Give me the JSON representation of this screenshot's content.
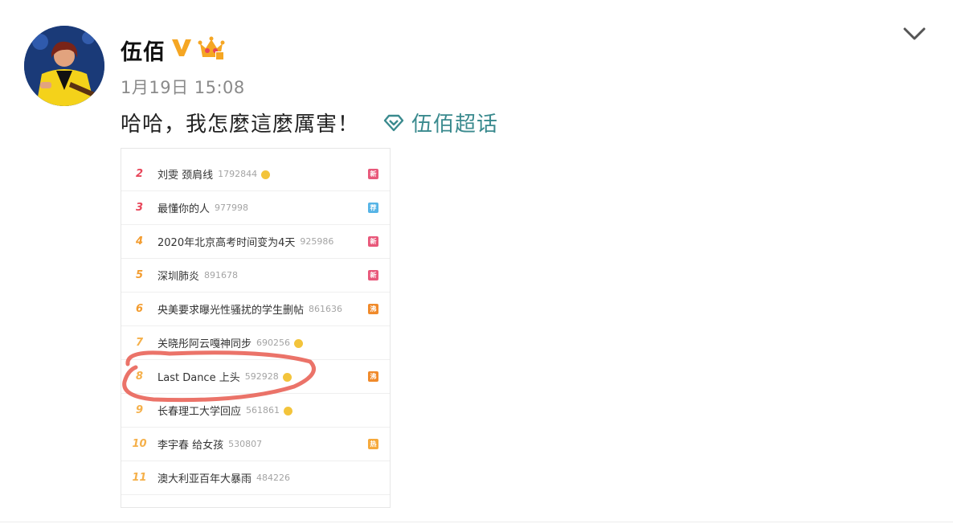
{
  "post": {
    "author": "伍佰",
    "timestamp": "1月19日 15:08",
    "text": "哈哈，我怎麼這麼厲害！",
    "topic_label": "伍佰超话",
    "verified_icon": "verified-v-icon",
    "member_icon": "crown-icon",
    "more_icon": "chevron-down-icon",
    "colors": {
      "verified": "#f5a623",
      "topic": "#3a8a8e",
      "highlight": "#e85a4f"
    }
  },
  "hot_list": [
    {
      "rank": "2",
      "title": "刘雯 颈肩线",
      "count": "1792844",
      "emoji": true,
      "tag": "新",
      "tag_color": "#e8587a",
      "rank_color": "#e8465a"
    },
    {
      "rank": "3",
      "title": "最懂你的人",
      "count": "977998",
      "emoji": false,
      "tag": "荐",
      "tag_color": "#56b4e6",
      "rank_color": "#e8465a"
    },
    {
      "rank": "4",
      "title": "2020年北京高考时间变为4天",
      "count": "925986",
      "emoji": false,
      "tag": "新",
      "tag_color": "#e8587a",
      "rank_color": "#f39c2f"
    },
    {
      "rank": "5",
      "title": "深圳肺炎",
      "count": "891678",
      "emoji": false,
      "tag": "新",
      "tag_color": "#e8587a",
      "rank_color": "#f39c2f"
    },
    {
      "rank": "6",
      "title": "央美要求曝光性骚扰的学生删帖",
      "count": "861636",
      "emoji": false,
      "tag": "沸",
      "tag_color": "#f08a2b",
      "rank_color": "#f39c2f"
    },
    {
      "rank": "7",
      "title": "关晓彤阿云嘎神同步",
      "count": "690256",
      "emoji": true,
      "tag": "",
      "tag_color": "#ffffff",
      "rank_color": "#f5b04a"
    },
    {
      "rank": "8",
      "title": "Last Dance 上头",
      "count": "592928",
      "emoji": true,
      "tag": "沸",
      "tag_color": "#f08a2b",
      "rank_color": "#f5b04a"
    },
    {
      "rank": "9",
      "title": "长春理工大学回应",
      "count": "561861",
      "emoji": true,
      "tag": "",
      "tag_color": "#ffffff",
      "rank_color": "#f5b04a"
    },
    {
      "rank": "10",
      "title": "李宇春 给女孩",
      "count": "530807",
      "emoji": false,
      "tag": "热",
      "tag_color": "#f6a93b",
      "rank_color": "#f5b04a"
    },
    {
      "rank": "11",
      "title": "澳大利亚百年大暴雨",
      "count": "484226",
      "emoji": false,
      "tag": "",
      "tag_color": "#ffffff",
      "rank_color": "#f5b04a"
    }
  ]
}
